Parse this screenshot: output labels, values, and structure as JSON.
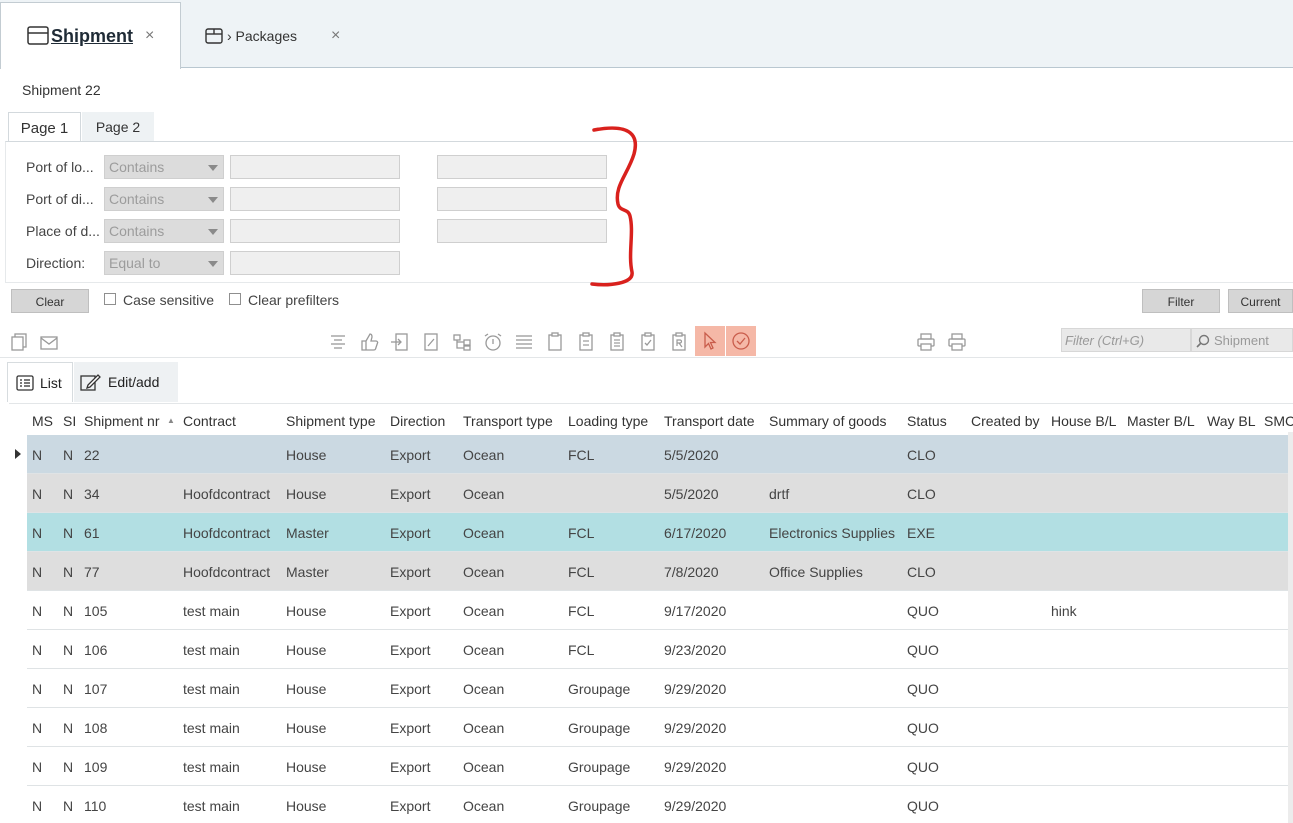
{
  "tabs": {
    "active_label": "Shipment",
    "active_close": "×",
    "second_label": "› Packages",
    "second_close": "×"
  },
  "record_title": "Shipment 22",
  "page_tabs": {
    "page1": "Page 1",
    "page2": "Page 2"
  },
  "filters": [
    {
      "label": "Port of lo...",
      "operator": "Contains"
    },
    {
      "label": "Port of di...",
      "operator": "Contains"
    },
    {
      "label": "Place of d...",
      "operator": "Contains"
    },
    {
      "label": "Direction:",
      "operator": "Equal to"
    }
  ],
  "filter_bar": {
    "clear": "Clear",
    "case_sensitive": "Case sensitive",
    "clear_prefilters": "Clear prefilters",
    "filter": "Filter",
    "current": "Current"
  },
  "search": {
    "placeholder": "Filter (Ctrl+G)",
    "scope": "Shipment"
  },
  "highlight_color": "#f5b8a7",
  "view_tabs": {
    "list": "List",
    "edit": "Edit/add"
  },
  "grid": {
    "columns": [
      "MS",
      "SI",
      "Shipment nr",
      "Contract",
      "Shipment type",
      "Direction",
      "Transport type",
      "Loading type",
      "Transport date",
      "Summary of goods",
      "Status",
      "Created by",
      "House B/L",
      "Master B/L",
      "Way BL",
      "SMC"
    ],
    "sort_indicator": "▲",
    "rows": [
      {
        "ms": "N",
        "si": "N",
        "nr": "22",
        "contract": "",
        "type": "House",
        "direction": "Export",
        "transport": "Ocean",
        "loading": "FCL",
        "date": "5/5/2020",
        "goods": "",
        "status": "CLO",
        "house_bl": ""
      },
      {
        "ms": "N",
        "si": "N",
        "nr": "34",
        "contract": "Hoofdcontract",
        "type": "House",
        "direction": "Export",
        "transport": "Ocean",
        "loading": "",
        "date": "5/5/2020",
        "goods": "drtf",
        "status": "CLO",
        "house_bl": ""
      },
      {
        "ms": "N",
        "si": "N",
        "nr": "61",
        "contract": "Hoofdcontract",
        "type": "Master",
        "direction": "Export",
        "transport": "Ocean",
        "loading": "FCL",
        "date": "6/17/2020",
        "goods": "Electronics Supplies",
        "status": "EXE",
        "house_bl": ""
      },
      {
        "ms": "N",
        "si": "N",
        "nr": "77",
        "contract": "Hoofdcontract",
        "type": "Master",
        "direction": "Export",
        "transport": "Ocean",
        "loading": "FCL",
        "date": "7/8/2020",
        "goods": "Office Supplies",
        "status": "CLO",
        "house_bl": ""
      },
      {
        "ms": "N",
        "si": "N",
        "nr": "105",
        "contract": "test main",
        "type": "House",
        "direction": "Export",
        "transport": "Ocean",
        "loading": "FCL",
        "date": "9/17/2020",
        "goods": "",
        "status": "QUO",
        "house_bl": "hink"
      },
      {
        "ms": "N",
        "si": "N",
        "nr": "106",
        "contract": "test main",
        "type": "House",
        "direction": "Export",
        "transport": "Ocean",
        "loading": "FCL",
        "date": "9/23/2020",
        "goods": "",
        "status": "QUO",
        "house_bl": ""
      },
      {
        "ms": "N",
        "si": "N",
        "nr": "107",
        "contract": "test main",
        "type": "House",
        "direction": "Export",
        "transport": "Ocean",
        "loading": "Groupage",
        "date": "9/29/2020",
        "goods": "",
        "status": "QUO",
        "house_bl": ""
      },
      {
        "ms": "N",
        "si": "N",
        "nr": "108",
        "contract": "test main",
        "type": "House",
        "direction": "Export",
        "transport": "Ocean",
        "loading": "Groupage",
        "date": "9/29/2020",
        "goods": "",
        "status": "QUO",
        "house_bl": ""
      },
      {
        "ms": "N",
        "si": "N",
        "nr": "109",
        "contract": "test main",
        "type": "House",
        "direction": "Export",
        "transport": "Ocean",
        "loading": "Groupage",
        "date": "9/29/2020",
        "goods": "",
        "status": "QUO",
        "house_bl": ""
      },
      {
        "ms": "N",
        "si": "N",
        "nr": "110",
        "contract": "test main",
        "type": "House",
        "direction": "Export",
        "transport": "Ocean",
        "loading": "Groupage",
        "date": "9/29/2020",
        "goods": "",
        "status": "QUO",
        "house_bl": ""
      }
    ]
  }
}
